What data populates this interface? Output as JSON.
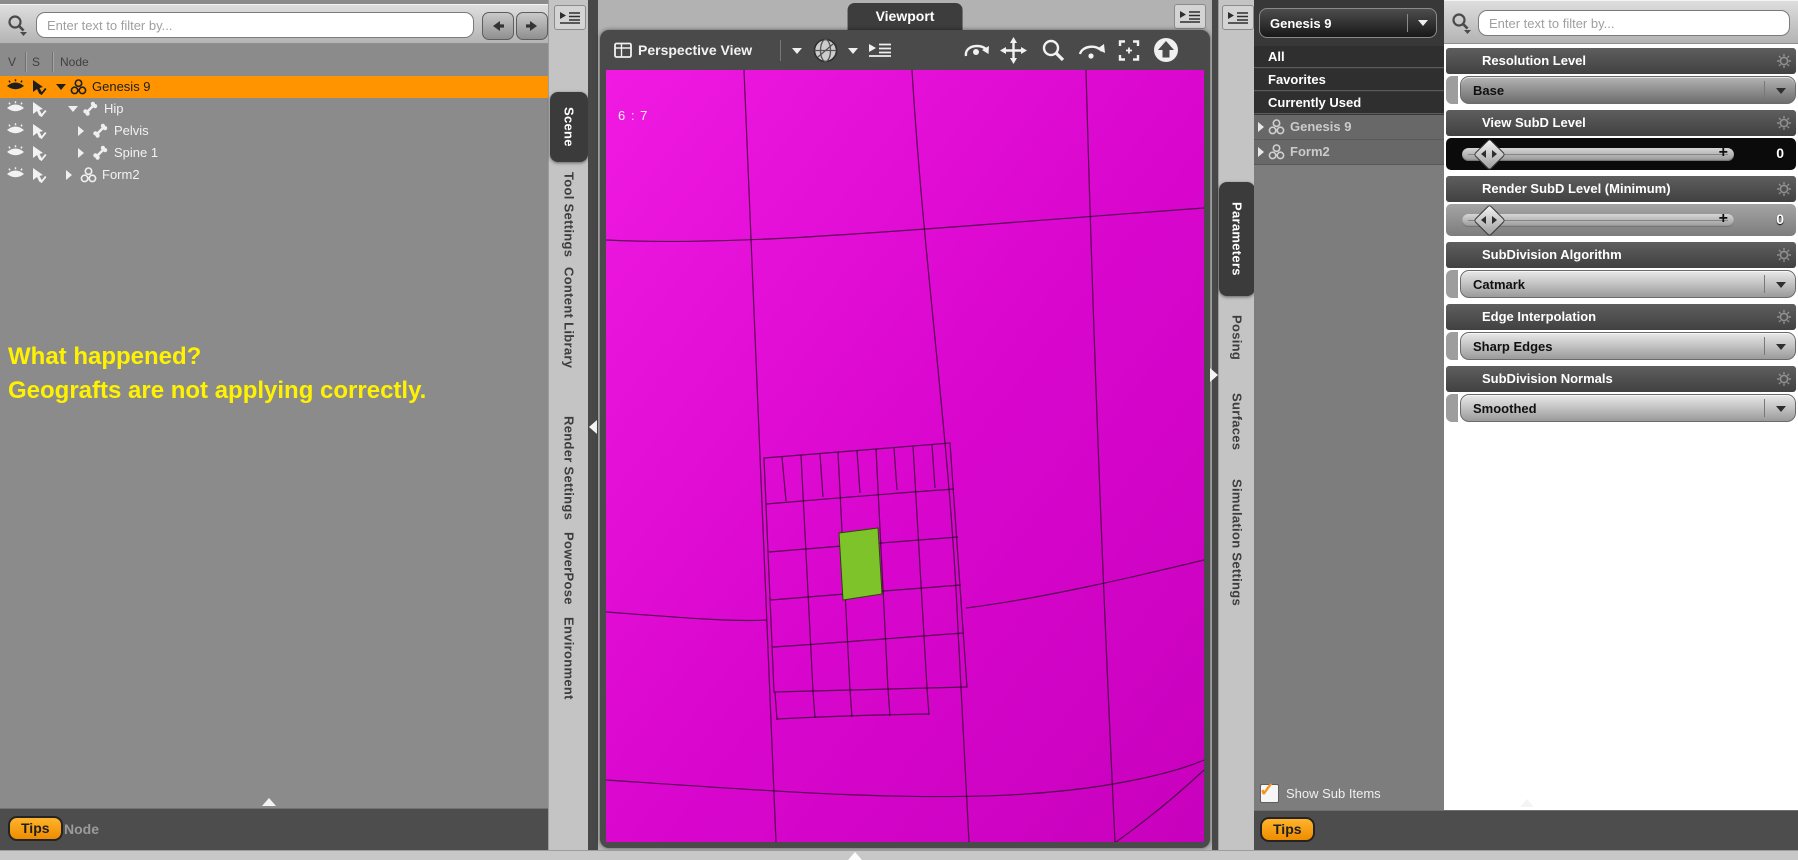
{
  "scene_panel": {
    "filter_placeholder": "Enter text to filter by...",
    "columns": {
      "v": "V",
      "s": "S",
      "node": "Node"
    },
    "nodes": {
      "genesis": "Genesis 9",
      "hip": "Hip",
      "pelvis": "Pelvis",
      "spine1": "Spine 1",
      "form2": "Form2"
    },
    "annotation": {
      "line1": "What happened?",
      "line2": "Geografts are not applying correctly."
    },
    "footer": {
      "tips": "Tips",
      "node": "Node"
    }
  },
  "left_tabs": {
    "scene": "Scene",
    "tool_settings": "Tool Settings",
    "content_library": "Content Library",
    "render_settings": "Render Settings",
    "powerpose": "PowerPose",
    "environment": "Environment"
  },
  "viewport": {
    "title": "Viewport",
    "view_mode": "Perspective View",
    "poly_ratio_label": "6 : 7"
  },
  "right_tabs": {
    "parameters": "Parameters",
    "posing": "Posing",
    "surfaces": "Surfaces",
    "simulation_settings": "Simulation Settings"
  },
  "params_panel": {
    "scene_selector": "Genesis 9",
    "filter_placeholder": "Enter text to filter by...",
    "list": {
      "all": "All",
      "favorites": "Favorites",
      "currently_used": "Currently Used"
    },
    "nodes": {
      "genesis": "Genesis 9",
      "form2": "Form2"
    },
    "groups": [
      {
        "title": "Resolution Level",
        "value": "Base"
      },
      {
        "title": "View SubD Level",
        "value": "0"
      },
      {
        "title": "Render SubD Level (Minimum)",
        "value": "0"
      },
      {
        "title": "SubDivision Algorithm",
        "value": "Catmark"
      },
      {
        "title": "Edge Interpolation",
        "value": "Sharp Edges"
      },
      {
        "title": "SubDivision Normals",
        "value": "Smoothed"
      }
    ],
    "show_sub_items": "Show Sub Items",
    "tips": "Tips"
  },
  "colors": {
    "selection_orange": "#FF9400",
    "accent_orange": "#F7941D",
    "viewport_magenta": "#D904CE",
    "geograft_green": "#7EC32A",
    "annotation_yellow": "#FFF200"
  }
}
